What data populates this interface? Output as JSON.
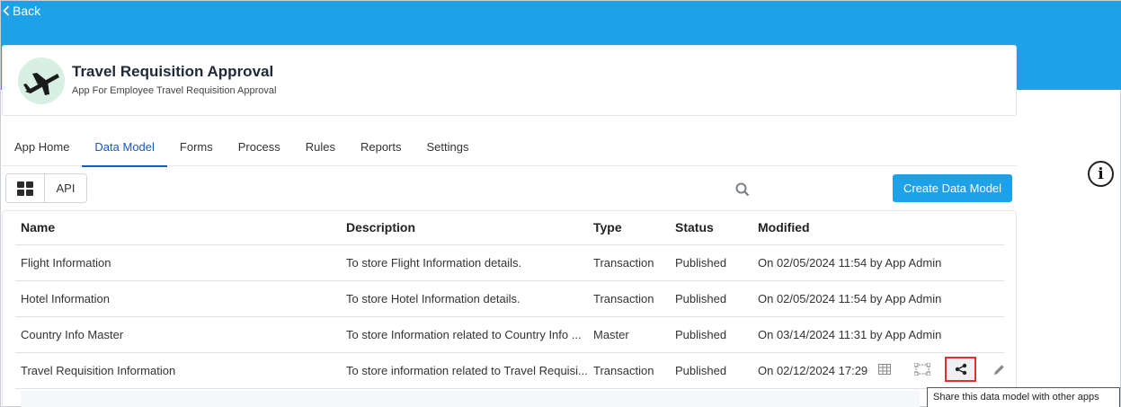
{
  "nav": {
    "back_label": "Back"
  },
  "app": {
    "title": "Travel Requisition Approval",
    "subtitle": "App For Employee Travel Requisition Approval",
    "logo_icon": "airplane-icon"
  },
  "tabs": [
    {
      "label": "App Home",
      "active": false
    },
    {
      "label": "Data Model",
      "active": true
    },
    {
      "label": "Forms",
      "active": false
    },
    {
      "label": "Process",
      "active": false
    },
    {
      "label": "Rules",
      "active": false
    },
    {
      "label": "Reports",
      "active": false
    },
    {
      "label": "Settings",
      "active": false
    }
  ],
  "toolbar": {
    "grid_icon": "grid-view-icon",
    "api_label": "API",
    "search_icon": "search-icon",
    "create_label": "Create Data Model"
  },
  "info_icon": "info-icon",
  "table": {
    "headers": [
      "Name",
      "Description",
      "Type",
      "Status",
      "Modified"
    ],
    "rows": [
      [
        "Flight Information",
        "To store Flight Information details.",
        "Transaction",
        "Published",
        "On 02/05/2024 11:54 by App Admin"
      ],
      [
        "Hotel Information",
        "To store Hotel Information details.",
        "Transaction",
        "Published",
        "On 02/05/2024 11:54 by App Admin"
      ],
      [
        "Country Info Master",
        "To store Information related to Country Info ...",
        "Master",
        "Published",
        "On 03/14/2024 11:31 by App Admin"
      ],
      [
        "Travel Requisition Information",
        "To store information related to Travel Requisi...",
        "Transaction",
        "Published",
        "On 02/12/2024 17:29"
      ]
    ]
  },
  "row_actions": {
    "icons": [
      "table-view-icon",
      "diagram-icon",
      "share-icon",
      "edit-icon"
    ],
    "tooltip": "Share this data model with other apps"
  },
  "colors": {
    "brand_blue": "#1da1e8",
    "active_tab": "#1a56c9",
    "highlight_red": "#e03131"
  }
}
